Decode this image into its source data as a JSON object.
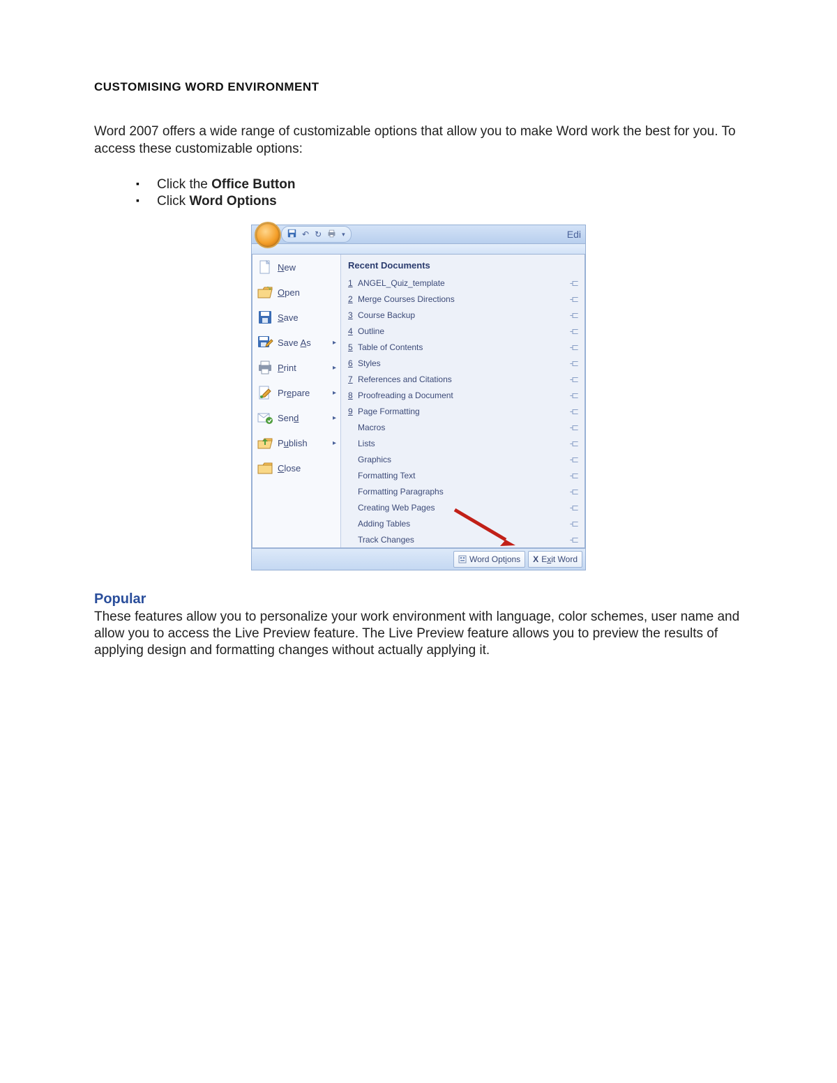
{
  "title": "CUSTOMISING WORD ENVIRONMENT",
  "intro": "Word 2007 offers a wide range of customizable options that allow you to make Word work the best for you.  To access these customizable options:",
  "bullets": [
    {
      "pre": "Click the ",
      "bold": "Office Button"
    },
    {
      "pre": "Click ",
      "bold": "Word Options"
    }
  ],
  "shot": {
    "edi_label": "Edi",
    "left_menu": [
      {
        "label": "New",
        "ul": "N",
        "rest": "ew",
        "has_sub": false,
        "icon": "new"
      },
      {
        "label": "Open",
        "ul": "O",
        "rest": "pen",
        "has_sub": false,
        "icon": "open"
      },
      {
        "label": "Save",
        "ul": "S",
        "rest": "ave",
        "has_sub": false,
        "icon": "save"
      },
      {
        "label": "Save As",
        "ul": "A",
        "pre": "Save ",
        "rest": "s",
        "has_sub": true,
        "icon": "saveas"
      },
      {
        "label": "Print",
        "ul": "P",
        "rest": "rint",
        "has_sub": true,
        "icon": "print"
      },
      {
        "label": "Prepare",
        "ul": "e",
        "pre": "Pr",
        "rest": "pare",
        "has_sub": true,
        "icon": "prepare"
      },
      {
        "label": "Send",
        "ul": "d",
        "pre": "Sen",
        "rest": "",
        "has_sub": true,
        "icon": "send"
      },
      {
        "label": "Publish",
        "ul": "u",
        "pre": "P",
        "rest": "blish",
        "has_sub": true,
        "icon": "publish"
      },
      {
        "label": "Close",
        "ul": "C",
        "rest": "lose",
        "has_sub": false,
        "icon": "close"
      }
    ],
    "recent_header": "Recent Documents",
    "recent": [
      {
        "n": "1",
        "name": "ANGEL_Quiz_template"
      },
      {
        "n": "2",
        "name": "Merge Courses Directions"
      },
      {
        "n": "3",
        "name": "Course Backup"
      },
      {
        "n": "4",
        "name": "Outline"
      },
      {
        "n": "5",
        "name": "Table of Contents"
      },
      {
        "n": "6",
        "name": "Styles"
      },
      {
        "n": "7",
        "name": "References and Citations"
      },
      {
        "n": "8",
        "name": "Proofreading a Document"
      },
      {
        "n": "9",
        "name": "Page Formatting"
      },
      {
        "n": "",
        "name": "Macros"
      },
      {
        "n": "",
        "name": "Lists"
      },
      {
        "n": "",
        "name": "Graphics"
      },
      {
        "n": "",
        "name": "Formatting Text"
      },
      {
        "n": "",
        "name": "Formatting Paragraphs"
      },
      {
        "n": "",
        "name": "Creating Web Pages"
      },
      {
        "n": "",
        "name": "Adding Tables"
      },
      {
        "n": "",
        "name": "Track Changes"
      }
    ],
    "footer": {
      "word_options": "Word Options",
      "word_options_ul": "i",
      "exit": "Exit Word",
      "exit_ul": "x"
    }
  },
  "popular": {
    "heading": "Popular",
    "body": "These features allow you to personalize your work environment with language, color schemes, user name and allow you to access the Live Preview feature.  The Live Preview feature allows you to preview the results of applying design and formatting changes without actually applying it."
  }
}
